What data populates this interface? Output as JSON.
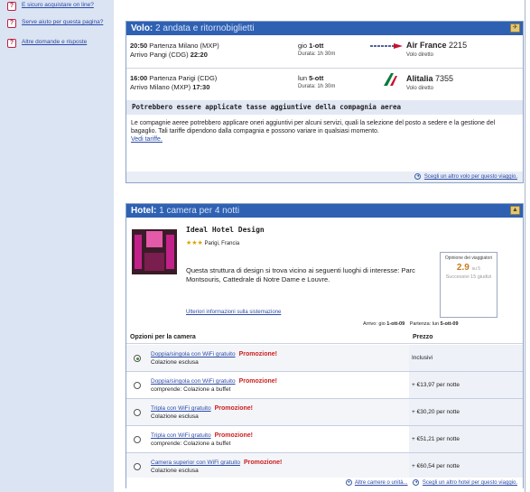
{
  "sidebar": {
    "items": [
      {
        "label": "E sicuro acquistare on line?"
      },
      {
        "label": "Serve aiuto per questa pagina?"
      },
      {
        "label": "Altre domande e risposte"
      }
    ]
  },
  "flight": {
    "header_title": "Volo:",
    "header_sub": "2 andata e ritornobiglietti",
    "outbound": {
      "depart_time": "20:50",
      "depart_text": "Partenza Milano (MXP)",
      "arrive_text": "Arrivo Pangi (CDG)",
      "arrive_time": "22:20",
      "date_prefix": "gio",
      "date": "1-ott",
      "duration": "Durata: 1h 30m",
      "airline": "Air France",
      "flight_no": "2215",
      "type": "Volo diretto"
    },
    "return": {
      "depart_time": "16:00",
      "depart_text": "Partenza Parigi (CDG)",
      "arrive_text": "Arrivo Milano (MXP)",
      "arrive_time": "17:30",
      "date_prefix": "lun",
      "date": "5-ott",
      "duration": "Durata: 1h 30m",
      "airline": "Alitalia",
      "flight_no": "7355",
      "type": "Volo diretto"
    },
    "notice_title": "Potrebbero essere applicate tasse aggiuntive della compagnia aerea",
    "notice_text": "Le compagnie aeree potrebbero applicare oneri aggiuntivi per alcuni servizi, quali la selezione del posto a sedere e la gestione del bagaglio. Tali tariffe dipendono dalla compagnia e possono variare in qualsiasi momento.",
    "notice_link": "Vedi tariffe.",
    "footer_link": "Scegli un altro volo per questo viaggio."
  },
  "hotel": {
    "header_title": "Hotel:",
    "header_sub": "1 camera per 4 notti",
    "name": "Ideal Hotel Design",
    "stars": "★★★",
    "location": "Parigi, Francia",
    "description": "Questa struttura di design si trova vicino ai seguenti luoghi di interesse: Parc Montsouris, Cattedrale di Notre Dame e Louvre.",
    "info_link": "Ulteriori informazioni sulla sistemazione",
    "rating": {
      "label": "Opinione dei viaggiatori",
      "score": "2.9",
      "max": "su 5",
      "next": "Successivi 15 giudizi"
    },
    "arrival_label": "Arrivo: gio",
    "arrival_date": "1-ott-09",
    "departure_label": "Partenza: lun",
    "departure_date": "5-ott-09",
    "options_header": "Opzioni per la camera",
    "price_header": "Prezzo",
    "options": [
      {
        "name": "Doppia/singola con WiFi gratuito",
        "promo": "Promozione!",
        "detail": "Colazione esclusa",
        "price": "Inclusivi",
        "selected": true
      },
      {
        "name": "Doppia/singola con WiFi gratuito",
        "promo": "Promozione!",
        "detail": "comprende: Colazione a buffet",
        "price": "+ €13,97 per notte",
        "selected": false
      },
      {
        "name": "Tripla con WiFi gratuito",
        "promo": "Promozione!",
        "detail": "Colazione esclusa",
        "price": "+ €30,20 per notte",
        "selected": false
      },
      {
        "name": "Tripla con WiFi gratuito",
        "promo": "Promozione!",
        "detail": "comprende: Colazione a buffet",
        "price": "+ €51,21 per notte",
        "selected": false
      },
      {
        "name": "Camera superior con WiFi gratuito",
        "promo": "Promozione!",
        "detail": "Colazione esclusa",
        "price": "+ €60,54 per notte",
        "selected": false
      }
    ],
    "footer_link_1": "Altre camere o unità...",
    "footer_link_2": "Scegli un altro hotel per questo viaggio."
  }
}
